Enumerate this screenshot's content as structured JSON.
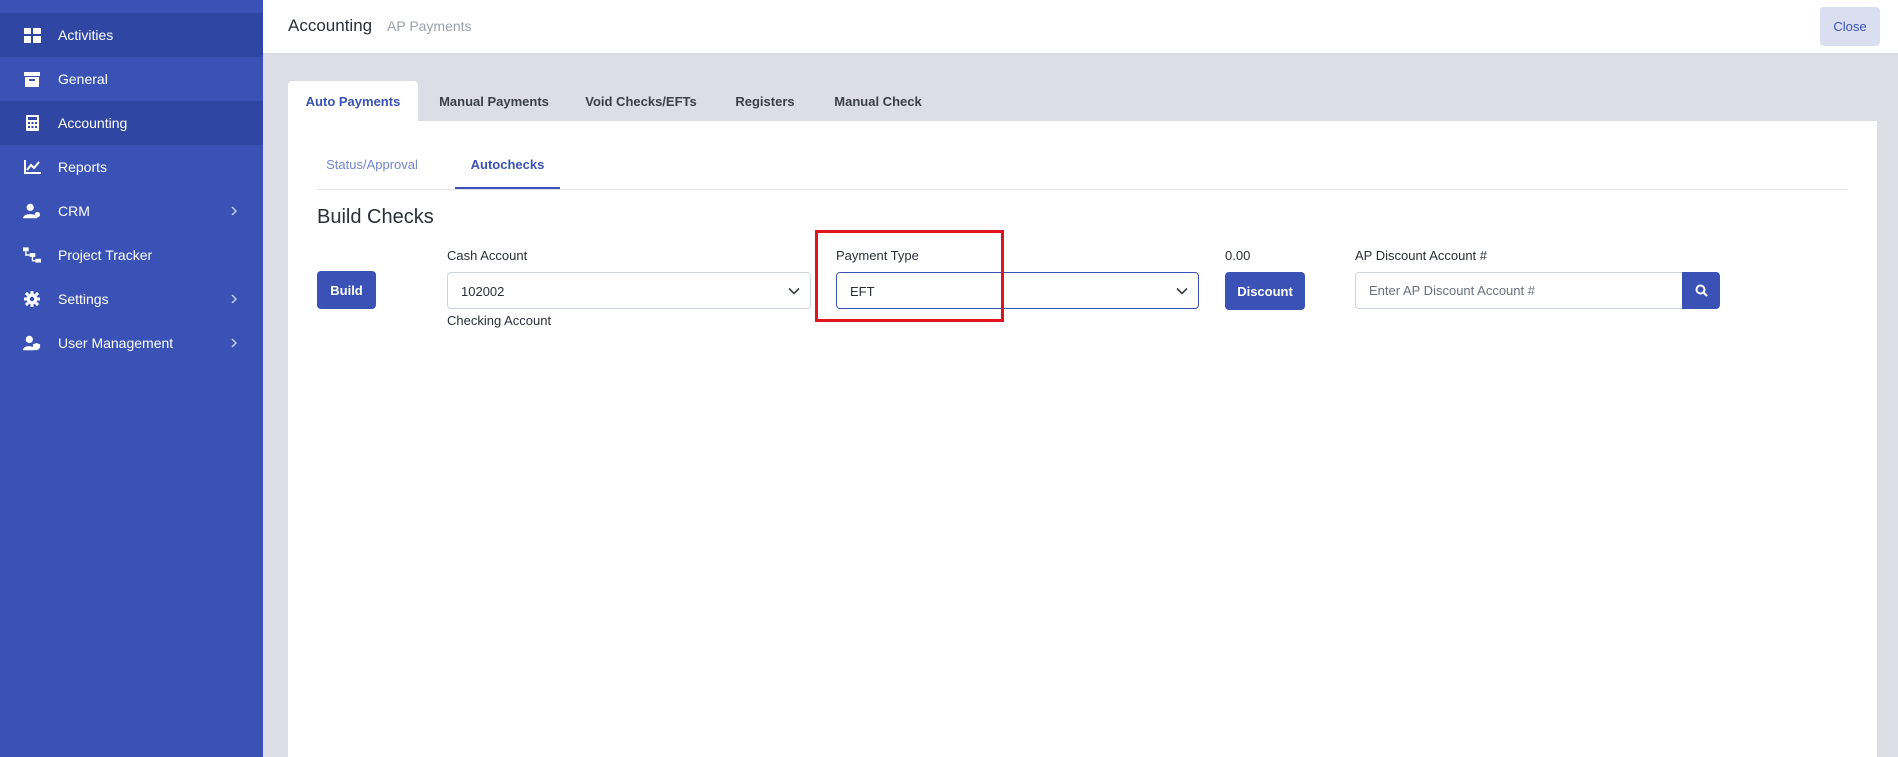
{
  "sidebar": {
    "items": [
      {
        "label": "Activities",
        "icon": "dashboard-icon",
        "active": true
      },
      {
        "label": "General",
        "icon": "archive-box-icon"
      },
      {
        "label": "Accounting",
        "icon": "calculator-icon",
        "active": true
      },
      {
        "label": "Reports",
        "icon": "line-chart-icon"
      },
      {
        "label": "CRM",
        "icon": "users-icon",
        "has_children": true
      },
      {
        "label": "Project Tracker",
        "icon": "sitemap-icon"
      },
      {
        "label": "Settings",
        "icon": "gear-icon",
        "has_children": true
      },
      {
        "label": "User Management",
        "icon": "user-shield-icon",
        "has_children": true
      }
    ]
  },
  "header": {
    "title": "Accounting",
    "subtitle": "AP Payments",
    "close_label": "Close"
  },
  "tabs": [
    {
      "label": "Auto Payments",
      "active": true
    },
    {
      "label": "Manual Payments"
    },
    {
      "label": "Void Checks/EFTs"
    },
    {
      "label": "Registers"
    },
    {
      "label": "Manual Check"
    }
  ],
  "subtabs": [
    {
      "label": "Status/Approval"
    },
    {
      "label": "Autochecks",
      "active": true
    }
  ],
  "section": {
    "title": "Build Checks",
    "build_label": "Build",
    "cash_account": {
      "label": "Cash Account",
      "value": "102002",
      "description": "Checking Account"
    },
    "payment_type": {
      "label": "Payment Type",
      "value": "EFT"
    },
    "discount": {
      "amount": "0.00",
      "button_label": "Discount"
    },
    "ap_discount": {
      "label": "AP Discount Account #",
      "placeholder": "Enter AP Discount Account #"
    }
  },
  "colors": {
    "sidebar_bg": "#3a52b6",
    "accent": "#3a52b6",
    "highlight": "#e0141e"
  }
}
